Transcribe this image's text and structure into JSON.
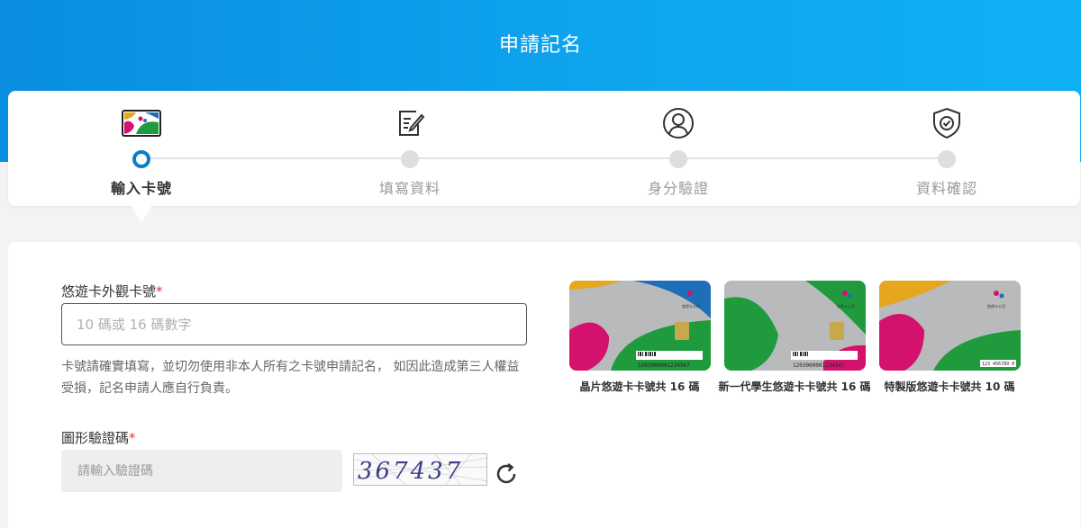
{
  "header": {
    "title": "申請記名"
  },
  "steps": [
    {
      "label": "輸入卡號",
      "icon": "easycard-logo-icon",
      "active": true
    },
    {
      "label": "填寫資料",
      "icon": "edit-document-icon",
      "active": false
    },
    {
      "label": "身分驗證",
      "icon": "user-circle-icon",
      "active": false
    },
    {
      "label": "資料確認",
      "icon": "shield-check-icon",
      "active": false
    }
  ],
  "form": {
    "card_number": {
      "label": "悠遊卡外觀卡號",
      "required_mark": "*",
      "placeholder": "10 碼或 16 碼數字",
      "value": "",
      "hint": "卡號請確實填寫，並切勿使用非本人所有之卡號申請記名， 如因此造成第三人權益受損，記名申請人應自行負責。"
    },
    "captcha": {
      "label": "圖形驗證碼",
      "required_mark": "*",
      "placeholder": "請輸入驗證碼",
      "value": "",
      "image_text": "367437",
      "refresh_icon": "refresh-icon"
    }
  },
  "samples": [
    {
      "caption": "晶片悠遊卡卡號共 16 碼",
      "number": "1203000001234567",
      "brand": "悠遊卡公司",
      "variant": "chip"
    },
    {
      "caption": "新一代學生悠遊卡卡號共 16 碼",
      "number": "1203000001234567",
      "brand": "悠遊卡公司",
      "variant": "student"
    },
    {
      "caption": "特製版悠遊卡卡號共 10 碼",
      "number": "123 456789 0",
      "brand": "悠遊卡公司",
      "variant": "special"
    }
  ],
  "colors": {
    "header_gradient_start": "#0a8ee0",
    "header_gradient_end": "#10b0f5",
    "active_step": "#0e7dc9",
    "required": "#e03b3b",
    "card_magenta": "#d4126e",
    "card_green": "#1f9a3c",
    "card_yellow": "#e6a71e",
    "card_blue": "#1e6fb8"
  }
}
